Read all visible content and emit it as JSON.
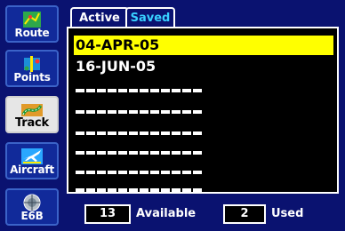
{
  "sidebar": {
    "items": [
      {
        "label": "Route",
        "icon": "route-icon"
      },
      {
        "label": "Points",
        "icon": "points-icon"
      },
      {
        "label": "Track",
        "icon": "track-icon",
        "active": true
      },
      {
        "label": "Aircraft",
        "icon": "aircraft-icon"
      },
      {
        "label": "E6B",
        "icon": "e6b-icon"
      }
    ]
  },
  "tabs": [
    {
      "label": "Active"
    },
    {
      "label": "Saved"
    }
  ],
  "list": {
    "items": [
      {
        "text": "04-APR-05",
        "selected": true
      },
      {
        "text": "16-JUN-05"
      }
    ]
  },
  "footer": {
    "available_count": "13",
    "available_label": "Available",
    "used_count": "2",
    "used_label": "Used"
  },
  "colors": {
    "background": "#0a1270",
    "selection": "#ffff00",
    "list_bg": "#000000",
    "tab_inactive_text": "#38d0ff"
  }
}
